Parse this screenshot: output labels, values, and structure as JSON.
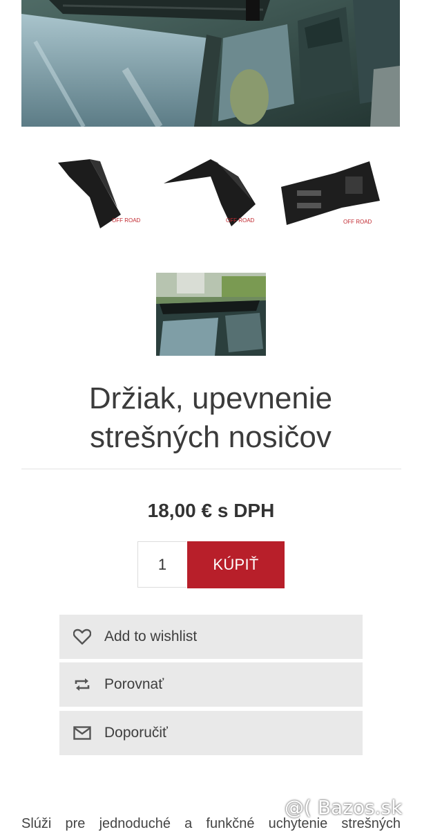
{
  "product": {
    "title_line1": "Držiak, upevnenie",
    "title_line2": "strešných nosičov",
    "price": "18,00 € s DPH",
    "quantity": "1",
    "buy_label": "KÚPIŤ"
  },
  "gallery": {
    "thumb_watermark": "OFF ROAD"
  },
  "actions": [
    {
      "label": "Add to wishlist",
      "icon": "heart-icon"
    },
    {
      "label": "Porovnať",
      "icon": "compare-arrows-icon"
    },
    {
      "label": "Doporučiť",
      "icon": "envelope-icon"
    }
  ],
  "description": {
    "text": "Slúži pre jednoduché a funkčné uchytenie strešných"
  },
  "watermark": {
    "text": "@( Bazos.sk"
  },
  "colors": {
    "accent": "#b81f2a",
    "action_bg": "#e9e9e9"
  }
}
